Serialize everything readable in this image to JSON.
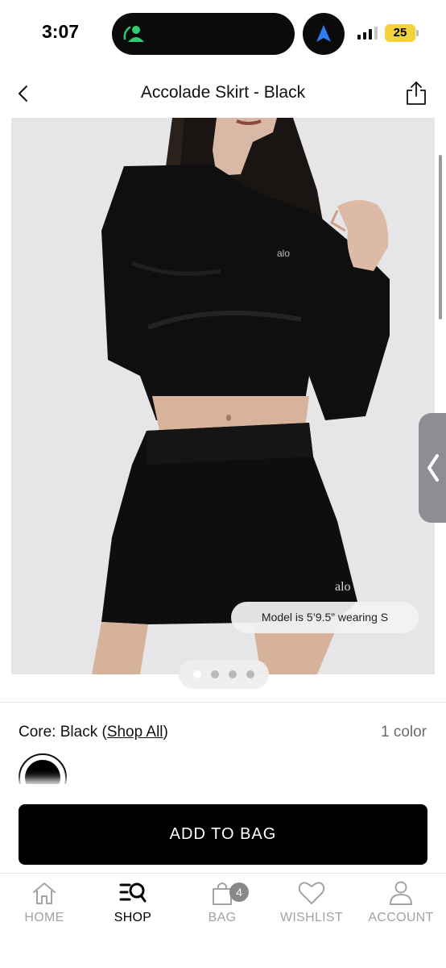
{
  "status_bar": {
    "time": "3:07",
    "battery": "25"
  },
  "header": {
    "title": "Accolade Skirt - Black"
  },
  "product": {
    "model_note": "Model is 5’9.5” wearing S",
    "image_count": 4,
    "active_image": 1
  },
  "color": {
    "label_prefix": "Core: Black (",
    "shop_all": "Shop All",
    "label_suffix": ")",
    "count": "1 color",
    "swatch_color": "#000000"
  },
  "cta": {
    "add_to_bag": "ADD TO BAG"
  },
  "tab_bar": {
    "items": [
      {
        "label": "HOME",
        "icon": "home-icon",
        "active": false
      },
      {
        "label": "SHOP",
        "icon": "shop-search-icon",
        "active": true
      },
      {
        "label": "BAG",
        "icon": "bag-icon",
        "active": false,
        "badge": "4"
      },
      {
        "label": "WISHLIST",
        "icon": "heart-icon",
        "active": false
      },
      {
        "label": "ACCOUNT",
        "icon": "person-icon",
        "active": false
      }
    ]
  },
  "colors": {
    "primary": "#000000",
    "inactive_tab": "#a3a3a3",
    "battery": "#f4d23b",
    "island_accent": "#2ecc71",
    "nav_arrow": "#2f7df6"
  }
}
